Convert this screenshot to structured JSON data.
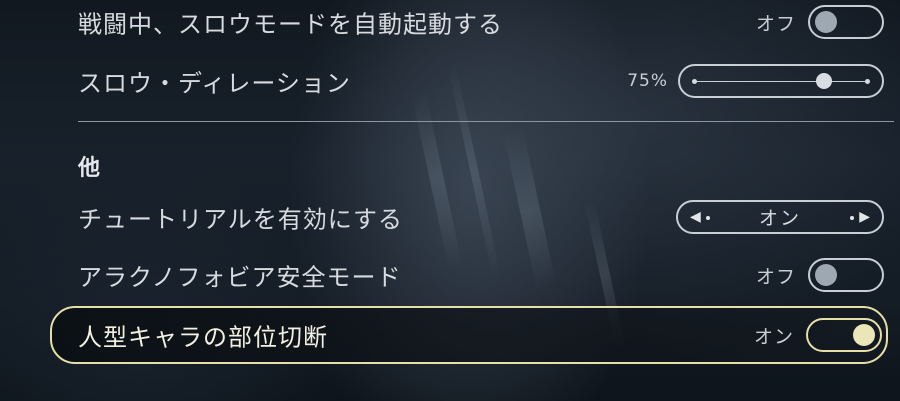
{
  "settings": {
    "auto_slow_mode": {
      "label": "戦闘中、スロウモードを自動起動する",
      "state_text": "オフ",
      "state": "off"
    },
    "slow_delay": {
      "label": "スロウ・ディレーション",
      "value_text": "75%",
      "value": 0.75
    },
    "other_section_title": "他",
    "tutorial": {
      "label": "チュートリアルを有効にする",
      "value": "オン"
    },
    "arachnophobia": {
      "label": "アラクノフォビア安全モード",
      "state_text": "オフ",
      "state": "off"
    },
    "humanoid_dismemberment": {
      "label": "人型キャラの部位切断",
      "state_text": "オン",
      "state": "on",
      "selected": true
    }
  },
  "icons": {
    "selector_left": "arrow-left-icon",
    "selector_right": "arrow-right-icon"
  },
  "colors": {
    "highlight": "#e6dfa8",
    "knob_on": "#ebe6b8",
    "knob_off": "#9ea8b3",
    "outline": "#c8ced6"
  }
}
